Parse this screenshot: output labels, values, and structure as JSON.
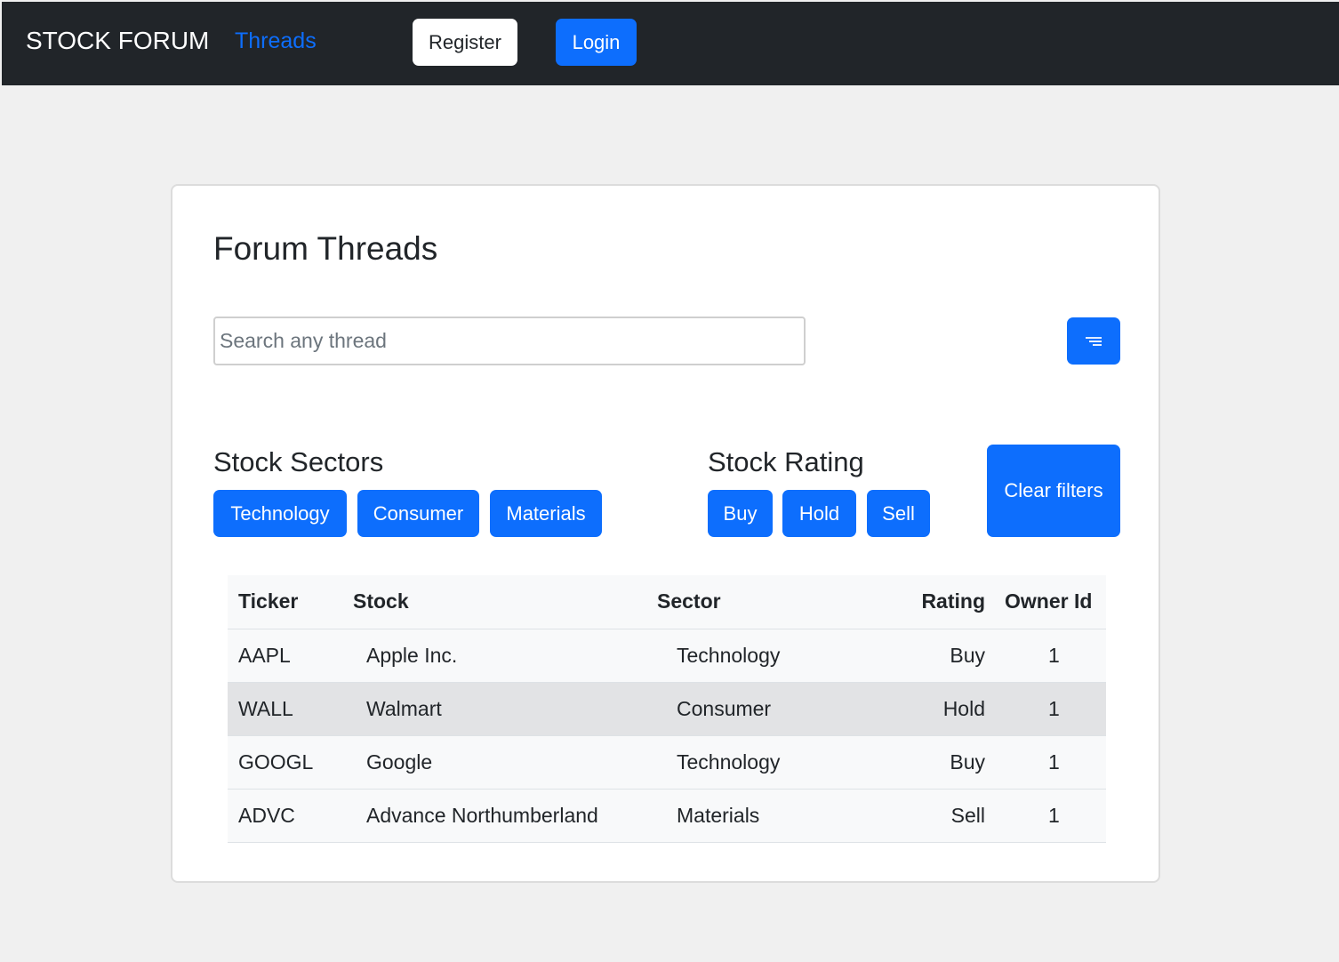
{
  "navbar": {
    "brand": "STOCK FORUM",
    "threads_link": "Threads",
    "register_label": "Register",
    "login_label": "Login"
  },
  "main": {
    "title": "Forum Threads",
    "search": {
      "placeholder": "Search any thread",
      "value": ""
    },
    "filter_icon": "filter-lines-icon",
    "sectors": {
      "title": "Stock Sectors",
      "buttons": [
        "Technology",
        "Consumer",
        "Materials"
      ]
    },
    "rating": {
      "title": "Stock Rating",
      "buttons": [
        "Buy",
        "Hold",
        "Sell"
      ]
    },
    "clear_label": "Clear filters",
    "table": {
      "headers": [
        "Ticker",
        "Stock",
        "Sector",
        "Rating",
        "Owner Id"
      ],
      "rows": [
        [
          "AAPL",
          "Apple Inc.",
          "Technology",
          "Buy",
          "1"
        ],
        [
          "WALL",
          "Walmart",
          "Consumer",
          "Hold",
          "1"
        ],
        [
          "GOOGL",
          "Google",
          "Technology",
          "Buy",
          "1"
        ],
        [
          "ADVC",
          "Advance Northumberland",
          "Materials",
          "Sell",
          "1"
        ]
      ]
    }
  },
  "colors": {
    "navbar_bg": "#212529",
    "primary": "#0d6efd",
    "page_bg": "#f0f0f0",
    "row_highlight": "#e2e3e5"
  }
}
